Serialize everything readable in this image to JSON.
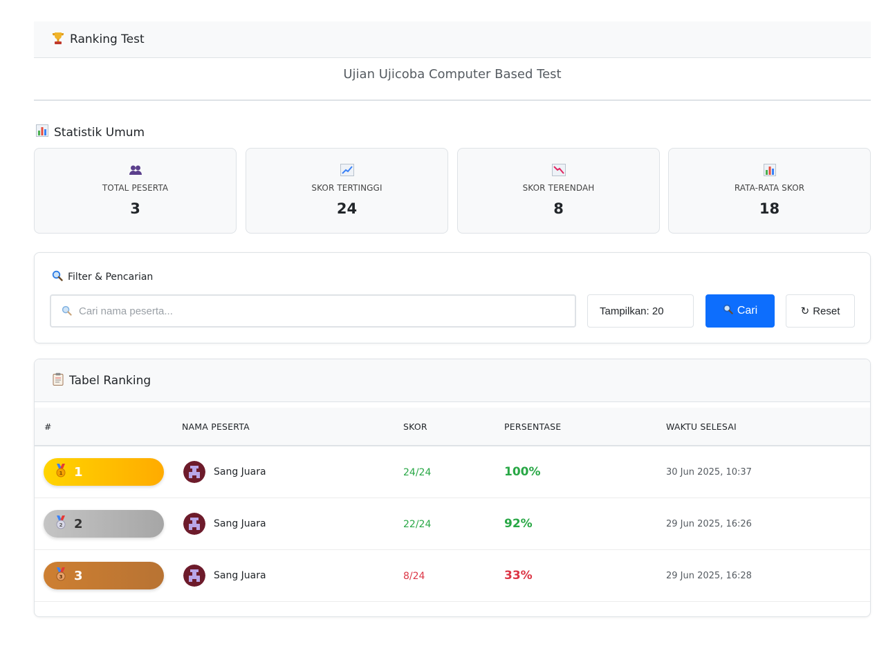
{
  "header": {
    "title": "Ranking Test",
    "subtitle": "Ujian Ujicoba Computer Based Test"
  },
  "stats": {
    "section_title": "Statistik Umum",
    "cards": [
      {
        "label": "TOTAL PESERTA",
        "value": "3",
        "icon": "people-icon"
      },
      {
        "label": "SKOR TERTINGGI",
        "value": "24",
        "icon": "chart-up-icon"
      },
      {
        "label": "SKOR TERENDAH",
        "value": "8",
        "icon": "chart-down-icon"
      },
      {
        "label": "RATA-RATA SKOR",
        "value": "18",
        "icon": "bar-chart-icon"
      }
    ]
  },
  "filter": {
    "title": "Filter & Pencarian",
    "search_placeholder": "Cari nama peserta...",
    "show_label": "Tampilkan: 20",
    "search_button": "Cari",
    "reset_button": "Reset"
  },
  "table": {
    "title": "Tabel Ranking",
    "columns": [
      "#",
      "NAMA PESERTA",
      "SKOR",
      "PERSENTASE",
      "WAKTU SELESAI"
    ],
    "rows": [
      {
        "rank": "1",
        "name": "Sang Juara",
        "score": "24/24",
        "percent": "100%",
        "time": "30 Jun 2025, 10:37",
        "medal": "gold",
        "status": "pass"
      },
      {
        "rank": "2",
        "name": "Sang Juara",
        "score": "22/24",
        "percent": "92%",
        "time": "29 Jun 2025, 16:26",
        "medal": "silver",
        "status": "pass"
      },
      {
        "rank": "3",
        "name": "Sang Juara",
        "score": "8/24",
        "percent": "33%",
        "time": "29 Jun 2025, 16:28",
        "medal": "bronze",
        "status": "fail"
      }
    ]
  },
  "colors": {
    "primary": "#0d6efd",
    "success": "#28a745",
    "danger": "#dc3545",
    "gold": "#ffc107",
    "silver": "#b5b5b5",
    "bronze": "#cd7f32"
  }
}
